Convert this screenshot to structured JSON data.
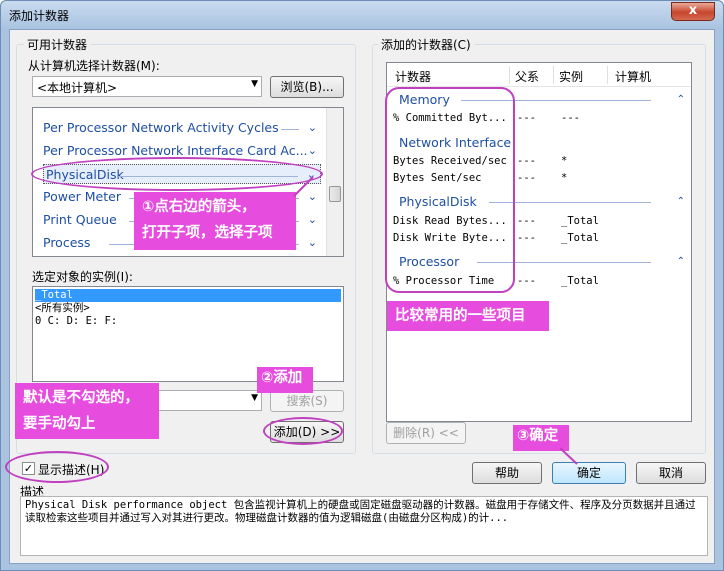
{
  "window": {
    "title": "添加计数器",
    "close_glyph": "x"
  },
  "available": {
    "group_title": "可用计数器",
    "machine_label": "从计算机选择计数器(M):",
    "machine_value": "<本地计算机>",
    "browse_button": "浏览(B)...",
    "counters": [
      {
        "name": "Per Processor Network Activity Cycles",
        "selected": false
      },
      {
        "name": "Per Processor Network Interface Card Ac...",
        "selected": false
      },
      {
        "name": "PhysicalDisk",
        "selected": true
      },
      {
        "name": "Power Meter",
        "selected": false
      },
      {
        "name": "Print Queue",
        "selected": false
      },
      {
        "name": "Process",
        "selected": false
      }
    ],
    "instances_label": "选定对象的实例(I):",
    "instances": [
      "_Total",
      "<所有实例>",
      "0 C: D: E: F:"
    ],
    "search_button": "搜索(S)",
    "add_button": "添加(D) >>"
  },
  "added": {
    "group_title": "添加的计数器(C)",
    "columns": [
      "计数器",
      "父系",
      "实例",
      "计算机"
    ],
    "groups": [
      {
        "category": "Memory",
        "rows": [
          {
            "counter": "% Committed Byt...",
            "parent": "---",
            "instance": "---"
          }
        ]
      },
      {
        "category": "Network Interface",
        "rows": [
          {
            "counter": "Bytes Received/sec",
            "parent": "---",
            "instance": "*"
          },
          {
            "counter": "Bytes Sent/sec",
            "parent": "---",
            "instance": "*"
          }
        ]
      },
      {
        "category": "PhysicalDisk",
        "rows": [
          {
            "counter": "Disk Read Bytes...",
            "parent": "---",
            "instance": "_Total"
          },
          {
            "counter": "Disk Write Byte...",
            "parent": "---",
            "instance": "_Total"
          }
        ]
      },
      {
        "category": "Processor",
        "rows": [
          {
            "counter": "% Processor Time",
            "parent": "---",
            "instance": "_Total"
          }
        ]
      }
    ],
    "delete_button": "删除(R) <<"
  },
  "footer": {
    "show_description_label": "显示描述(H)",
    "show_description_checked": true,
    "help_button": "帮助",
    "ok_button": "确定",
    "cancel_button": "取消",
    "description_label": "描述",
    "description_text": "Physical Disk performance object 包含监视计算机上的硬盘或固定磁盘驱动器的计数器。磁盘用于存储文件、程序及分页数据并且通过读取检索这些项目并通过写入对其进行更改。物理磁盘计数器的值为逻辑磁盘(由磁盘分区构成)的计..."
  },
  "annotations": {
    "step1_line1": "①点右边的箭头，",
    "step1_line2": "打开子项，选择子项",
    "step2": "②添加",
    "step3": "③确定",
    "common": "比较常用的一些项目",
    "default_line1": "默认是不勾选的，",
    "default_line2": "要手动勾上"
  },
  "colors": {
    "annotation": "#e64ddf",
    "outline": "#c040c0",
    "link_blue": "#1e4fa3"
  }
}
